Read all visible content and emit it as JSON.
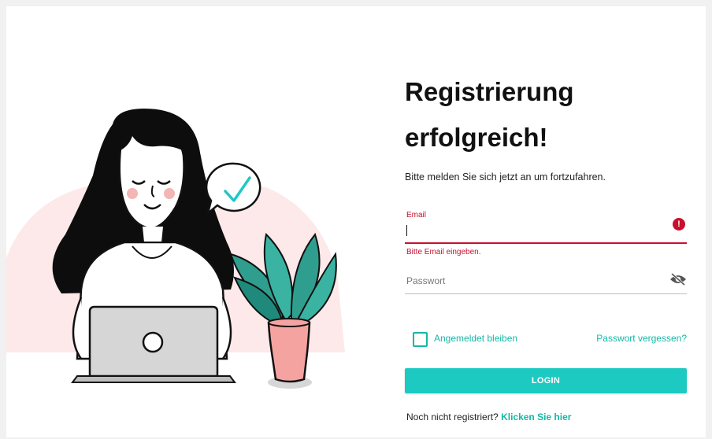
{
  "heading": {
    "line1": "Registrierung",
    "line2": "erfolgreich!"
  },
  "subtitle": "Bitte melden Sie sich jetzt an um fortzufahren.",
  "email": {
    "label": "Email",
    "value": "",
    "error": "Bitte Email eingeben.",
    "error_icon": "exclamation-icon"
  },
  "password": {
    "placeholder": "Passwort",
    "icon": "eye-slash-icon"
  },
  "remember": {
    "label": "Angemeldet bleiben",
    "checked": false
  },
  "forgot_link": "Passwort vergessen?",
  "login_button": "LOGIN",
  "register": {
    "prompt": "Noch nicht registriert?",
    "link": "Klicken Sie hier"
  },
  "colors": {
    "accent": "#1dcac2",
    "link": "#14b8a6",
    "error": "#c8102e",
    "blob": "#fde9e9",
    "plant_leaf": "#2f9e8f",
    "pot": "#f4a3a0"
  }
}
